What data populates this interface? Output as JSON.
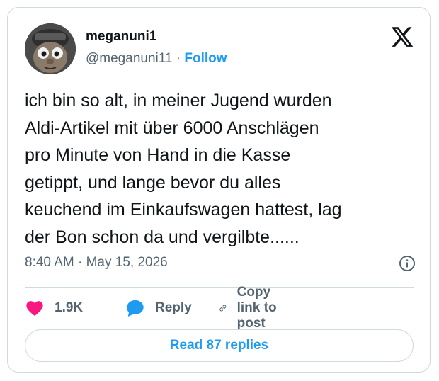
{
  "author": {
    "display_name": "meganuni1",
    "handle": "@meganuni11",
    "separator": "·",
    "follow_label": "Follow"
  },
  "tweet": {
    "text": "ich bin so alt, in meiner Jugend wurden\nAldi-Artikel mit über 6000 Anschlägen\npro Minute von Hand in die Kasse\ngetippt, und lange bevor du alles\nkeuchend im Einkaufswagen hattest, lag\nder Bon schon da und vergilbte......",
    "timestamp": "8:40 AM · May 15, 2026"
  },
  "actions": {
    "likes": "1.9K",
    "reply_label": "Reply",
    "copy_link_label": "Copy link to post"
  },
  "read_replies_label": "Read 87 replies",
  "colors": {
    "accent": "#1d9bf0",
    "like": "#f91880",
    "text_primary": "#0f1419",
    "text_secondary": "#536471",
    "border": "#cfd9de"
  },
  "icons": [
    "avatar",
    "x-logo-icon",
    "info-icon",
    "heart-icon",
    "reply-bubble-icon",
    "link-icon"
  ]
}
